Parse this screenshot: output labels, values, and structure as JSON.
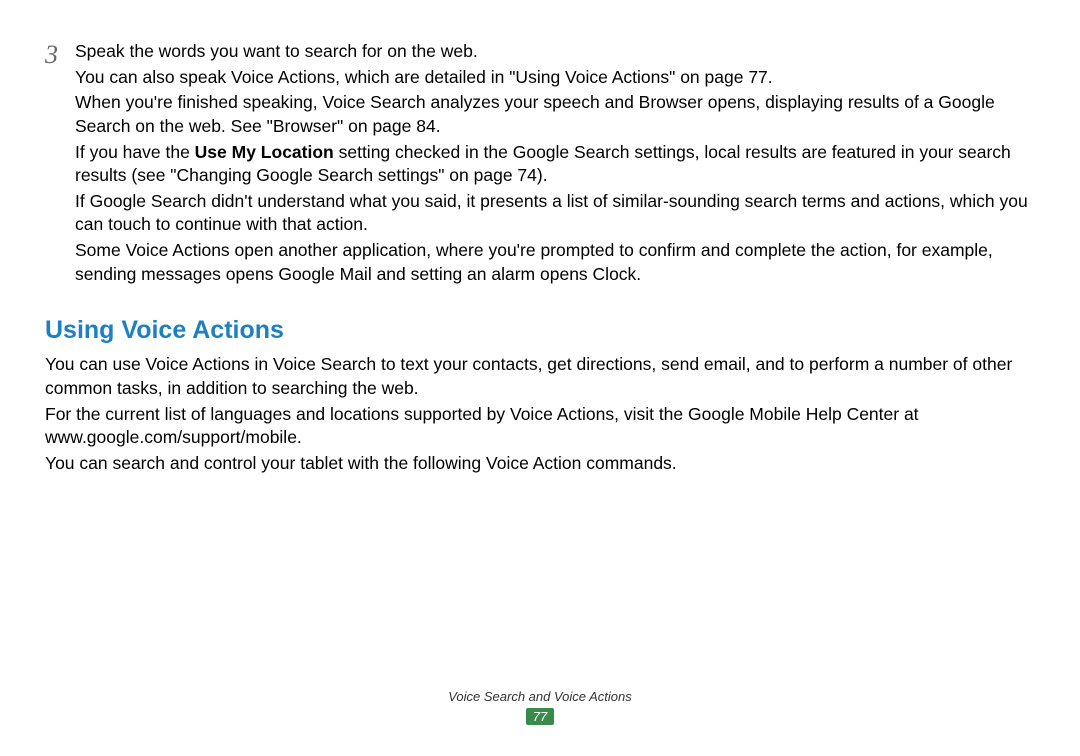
{
  "step": {
    "number": "3",
    "line1": "Speak the words you want to search for on the web.",
    "line2": "You can also speak Voice Actions, which are detailed in \"Using Voice Actions\" on page 77.",
    "line3": "When you're finished speaking, Voice Search analyzes your speech and Browser opens, displaying results of a Google Search on the web. See \"Browser\" on page 84.",
    "line4a": "If you have the ",
    "line4bold": "Use My Location",
    "line4b": " setting checked in the Google Search settings, local results are featured in your search results (see \"Changing Google Search settings\" on page 74).",
    "line5": "If Google Search didn't understand what you said, it presents a list of similar-sounding search terms and actions, which you can touch to continue with that action.",
    "line6": "Some Voice Actions open another application, where you're prompted to confirm and complete the action, for example, sending messages opens Google Mail and setting an alarm opens Clock."
  },
  "section": {
    "heading": "Using Voice Actions",
    "p1": "You can use Voice Actions in Voice Search to text your contacts, get directions, send email, and to perform a number of other common tasks, in addition to searching the web.",
    "p2": "For the current list of languages and locations supported by Voice Actions, visit the Google Mobile Help Center at www.google.com/support/mobile.",
    "p3": "You can search and control your tablet with the following Voice Action commands."
  },
  "footer": {
    "title": "Voice Search and Voice Actions",
    "page": "77"
  }
}
